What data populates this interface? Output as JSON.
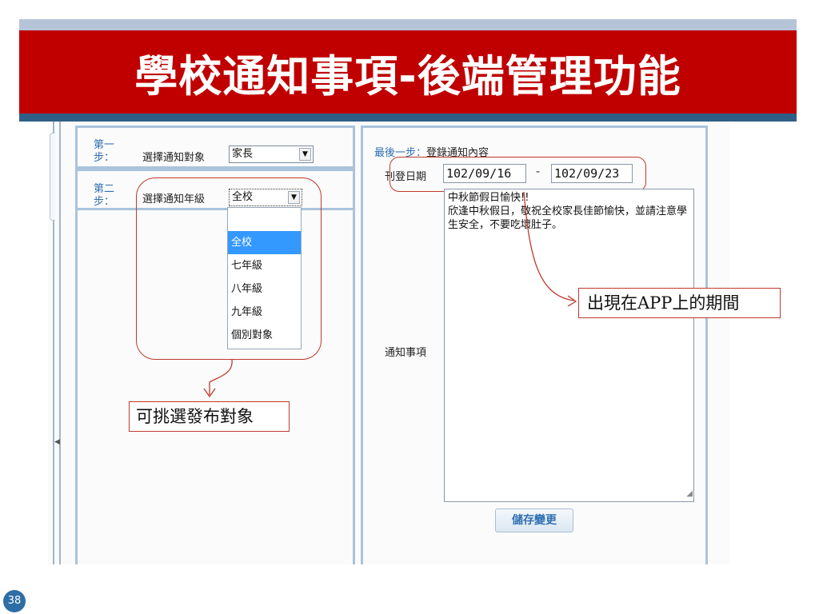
{
  "slide": {
    "title": "學校通知事項-後端管理功能",
    "page_number": "38"
  },
  "step1": {
    "label": "第一步：",
    "field_label": "選擇通知對象",
    "selected": "家長"
  },
  "step2": {
    "label": "第二步：",
    "field_label": "選擇通知年級",
    "selected": "全校",
    "options": [
      "",
      "全校",
      "七年級",
      "八年級",
      "九年級",
      "個別對象"
    ]
  },
  "final_step": {
    "label": "最後一步：",
    "title": "登錄通知內容",
    "date_label": "刊登日期",
    "start_date": "102/09/16",
    "separator": "-",
    "end_date": "102/09/23",
    "notice_label": "通知事項",
    "notice_text": "中秋節假日愉快!!\n欣逢中秋假日，敬祝全校家長佳節愉快，並請注意學生安全，不要吃壞肚子。",
    "save_label": "儲存變更"
  },
  "callouts": {
    "select_targets": "可挑選發布對象",
    "period": "出現在APP上的期間"
  },
  "colors": {
    "title_band": "#c00000",
    "accent_blue": "#2f6fb3",
    "callout_red": "#c0392b"
  }
}
